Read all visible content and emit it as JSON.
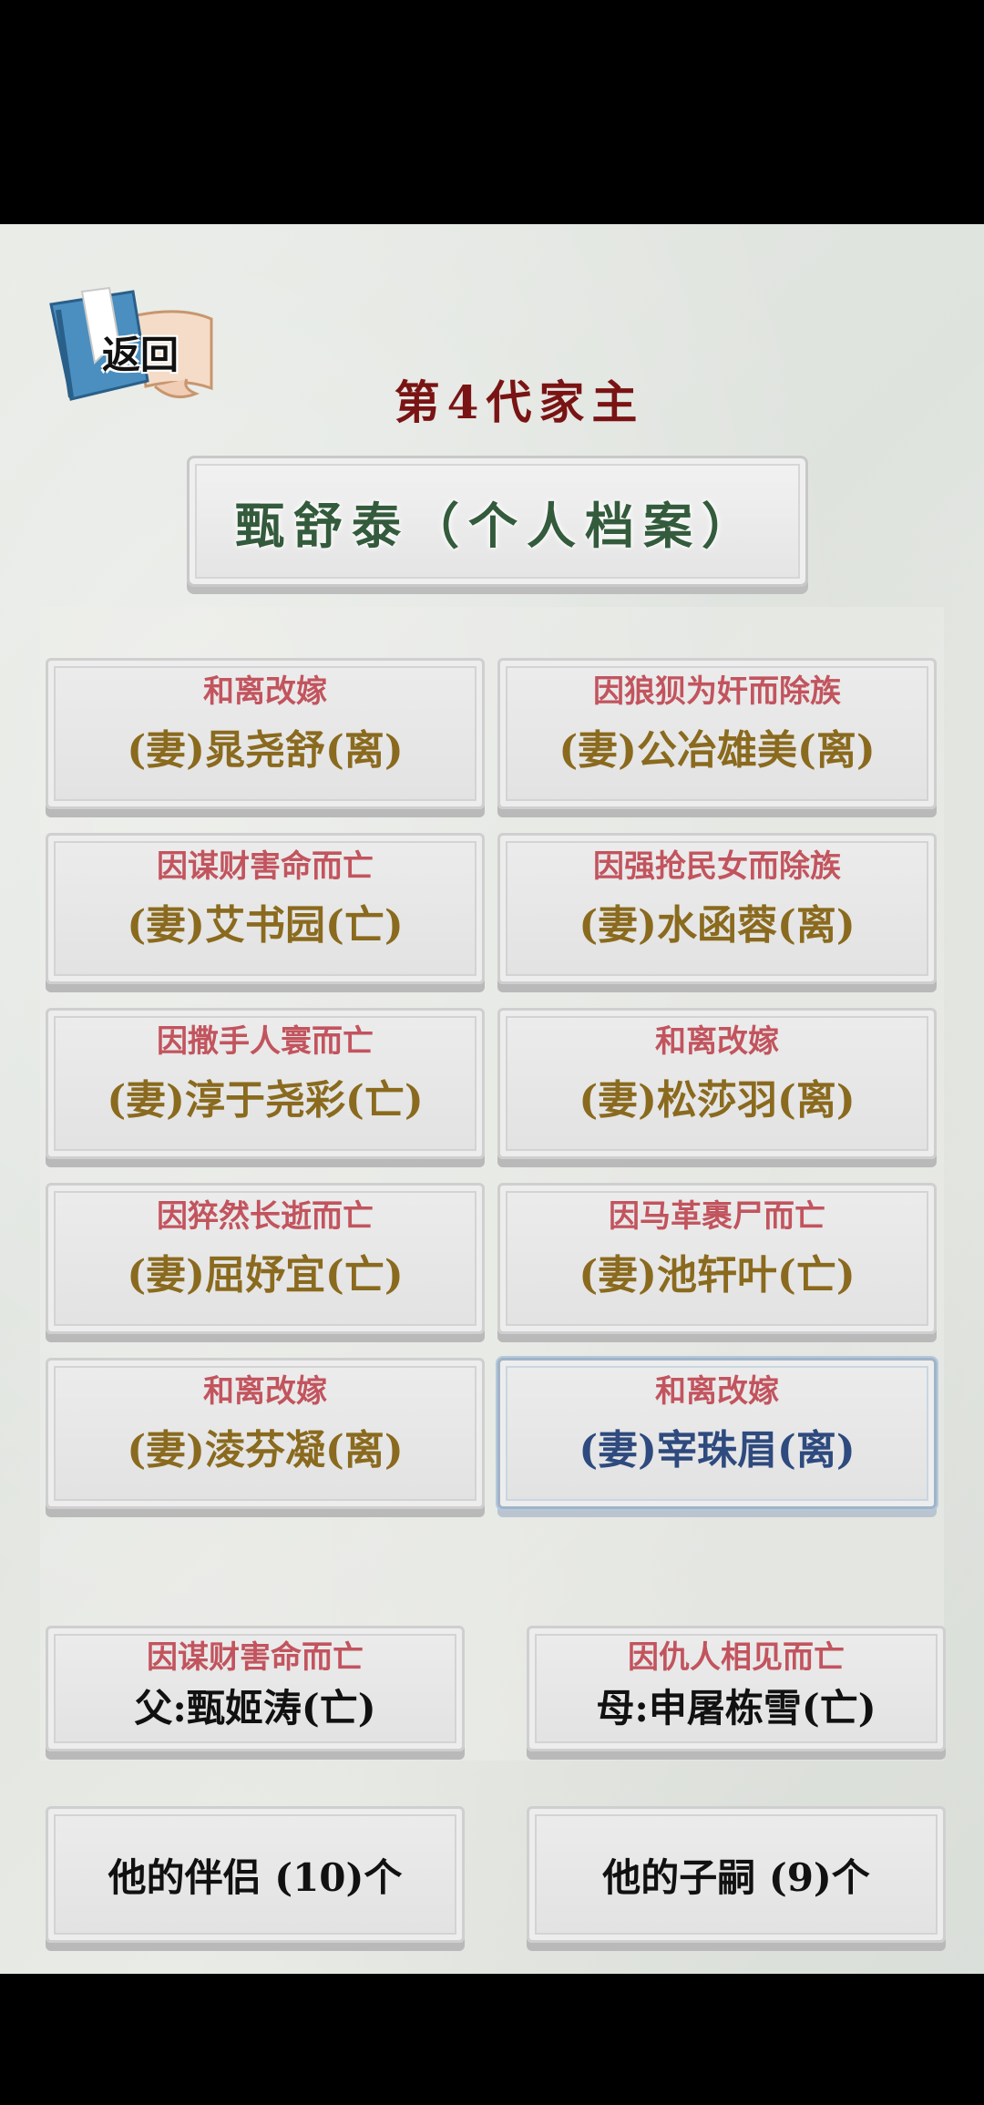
{
  "header": {
    "back_label": "返回",
    "generation_title": "第4代家主",
    "profile_title": "甄舒泰（个人档案）"
  },
  "spouses": [
    {
      "status": "和离改嫁",
      "name": "(妻)晁尧舒(离)"
    },
    {
      "status": "因狼狈为奸而除族",
      "name": "(妻)公冶雄美(离)"
    },
    {
      "status": "因谋财害命而亡",
      "name": "(妻)艾书园(亡)"
    },
    {
      "status": "因强抢民女而除族",
      "name": "(妻)水函蓉(离)"
    },
    {
      "status": "因撒手人寰而亡",
      "name": "(妻)淳于尧彩(亡)"
    },
    {
      "status": "和离改嫁",
      "name": "(妻)松莎羽(离)"
    },
    {
      "status": "因猝然长逝而亡",
      "name": "(妻)屈妤宜(亡)"
    },
    {
      "status": "因马革裹尸而亡",
      "name": "(妻)池轩叶(亡)"
    },
    {
      "status": "和离改嫁",
      "name": "(妻)淩芬凝(离)"
    },
    {
      "status": "和离改嫁",
      "name": "(妻)宰珠眉(离)"
    }
  ],
  "parents": {
    "father": {
      "status": "因谋财害命而亡",
      "name": "父:甄姬涛(亡)"
    },
    "mother": {
      "status": "因仇人相见而亡",
      "name": "母:申屠栋雪(亡)"
    }
  },
  "links": {
    "partners": "他的伴侣 (10)个",
    "children": "他的子嗣 (9)个"
  }
}
